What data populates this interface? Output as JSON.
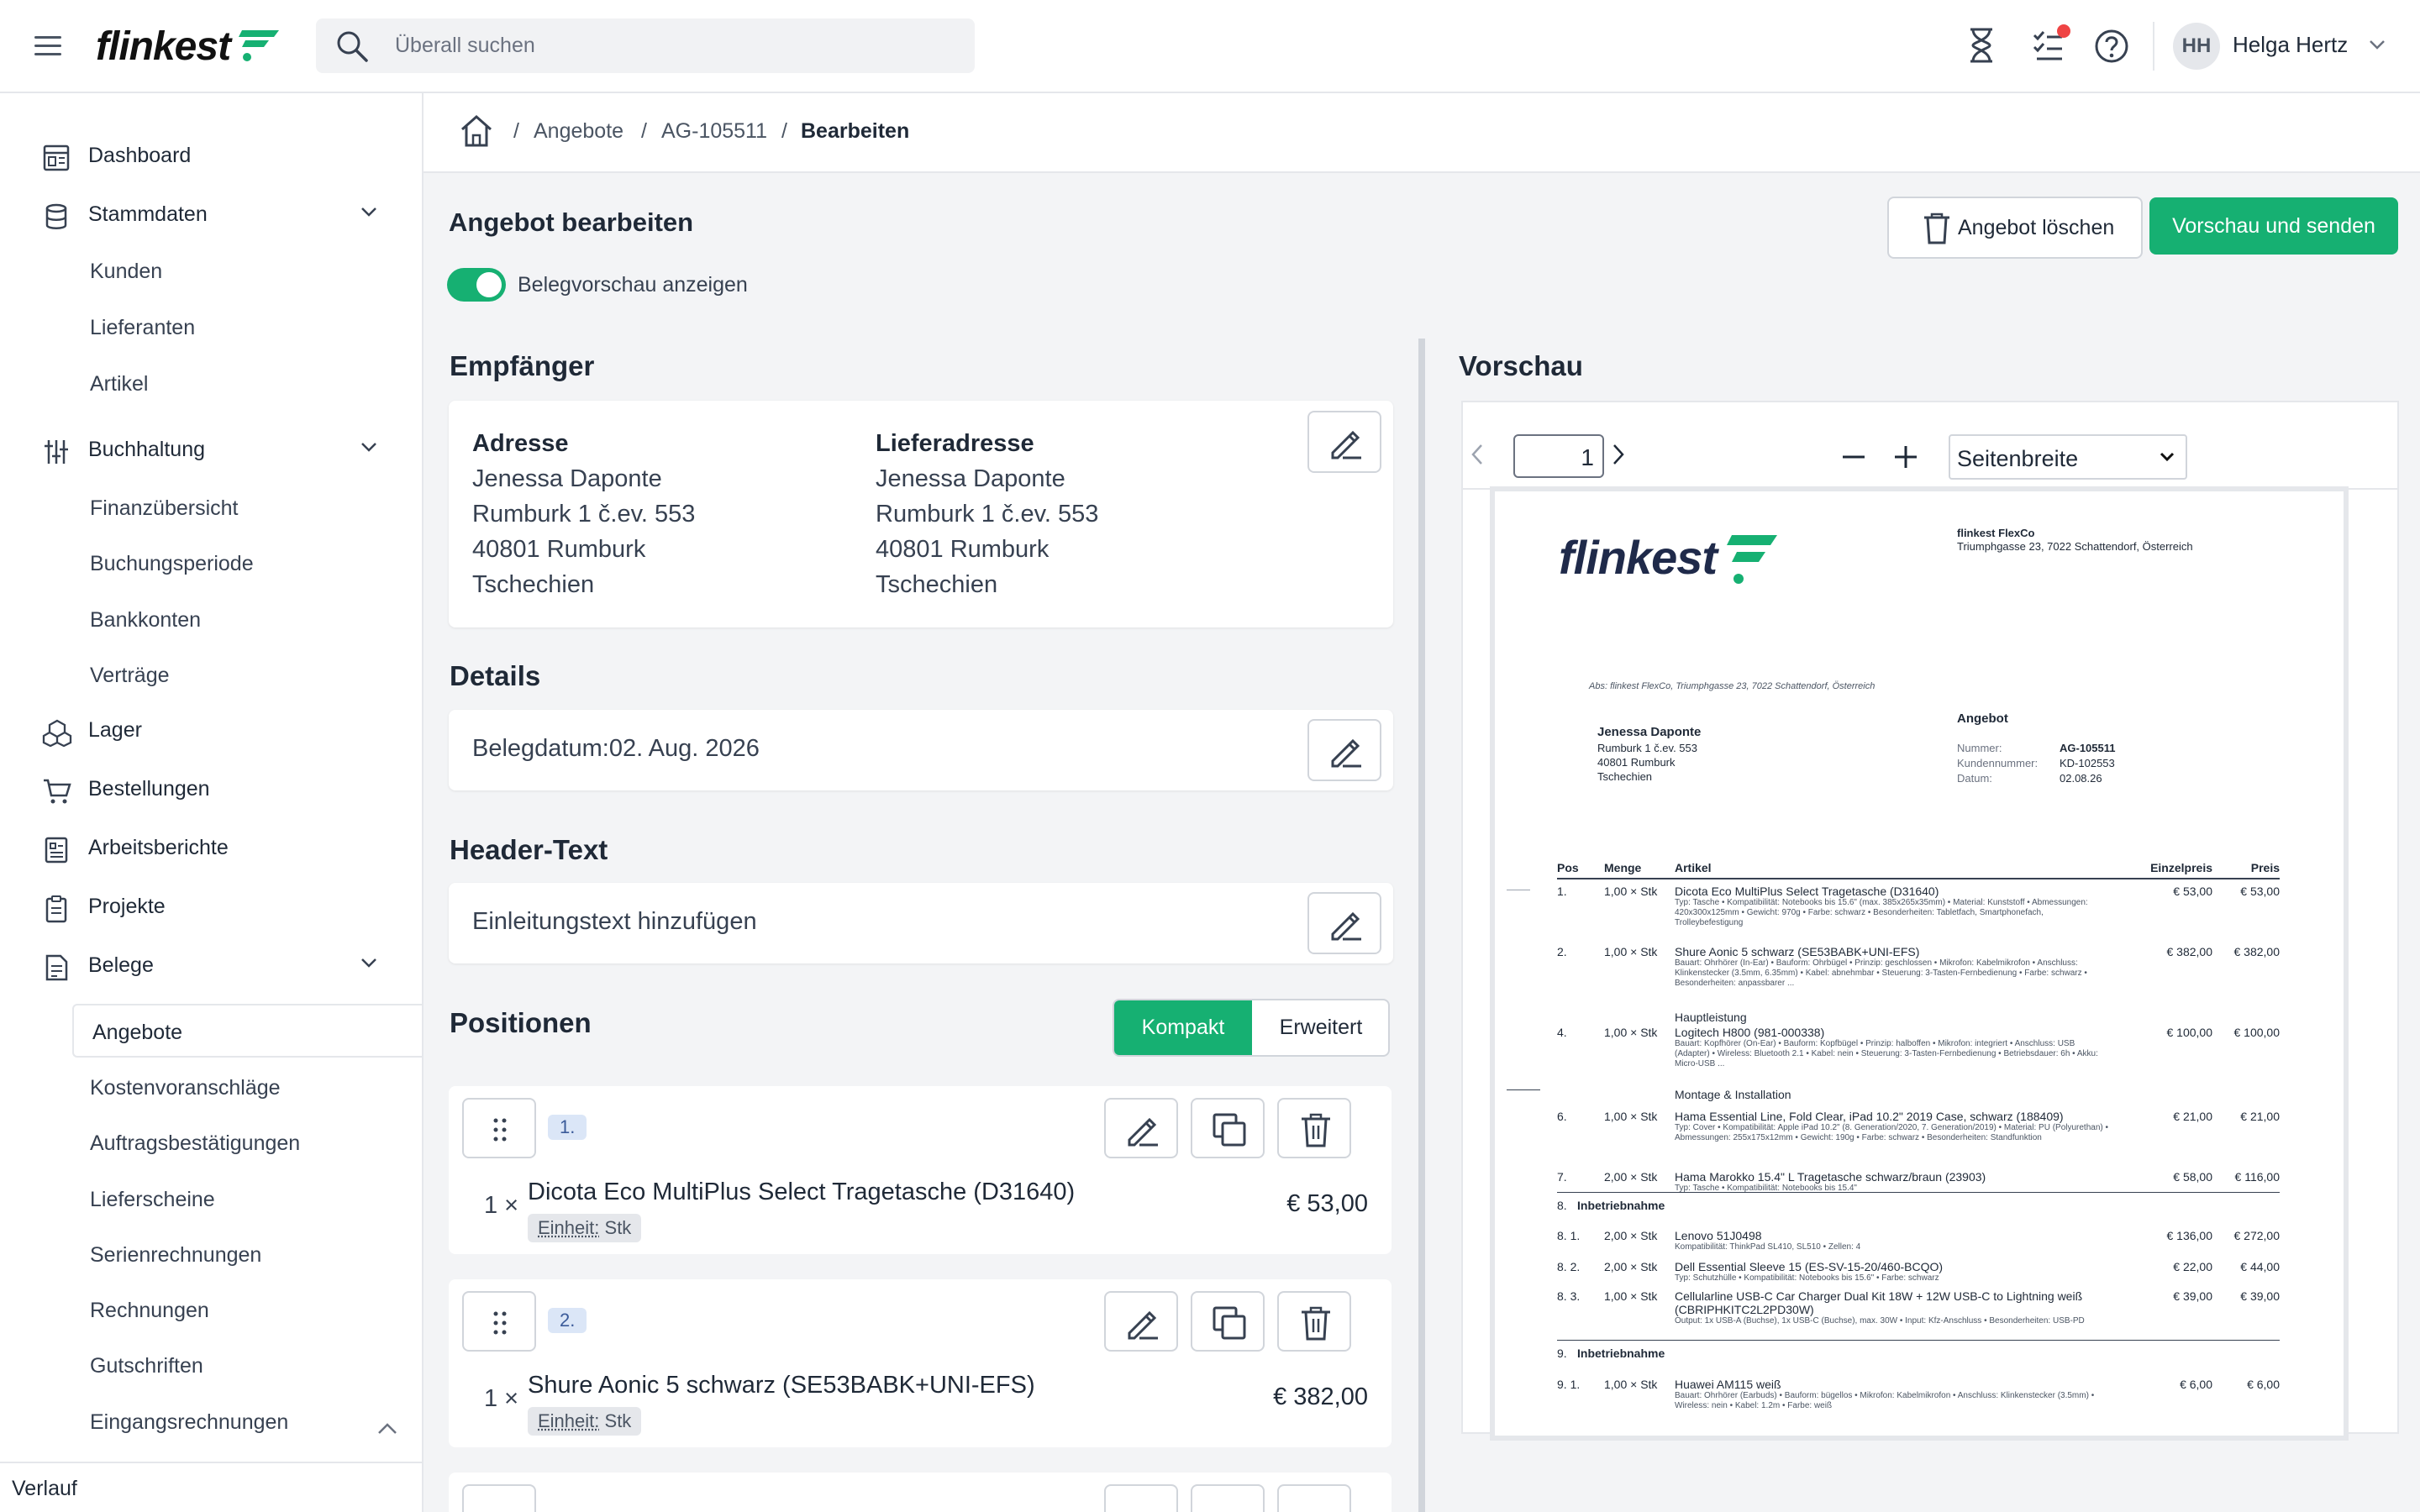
{
  "header": {
    "logo": "flinkest",
    "search_placeholder": "Überall suchen",
    "user_initials": "HH",
    "user_name": "Helga Hertz"
  },
  "sidebar": {
    "items": [
      {
        "label": "Dashboard"
      },
      {
        "label": "Stammdaten"
      },
      {
        "label": "Kunden"
      },
      {
        "label": "Lieferanten"
      },
      {
        "label": "Artikel"
      },
      {
        "label": "Buchhaltung"
      },
      {
        "label": "Finanzübersicht"
      },
      {
        "label": "Buchungsperiode"
      },
      {
        "label": "Bankkonten"
      },
      {
        "label": "Verträge"
      },
      {
        "label": "Lager"
      },
      {
        "label": "Bestellungen"
      },
      {
        "label": "Arbeitsberichte"
      },
      {
        "label": "Projekte"
      },
      {
        "label": "Belege"
      },
      {
        "label": "Angebote"
      },
      {
        "label": "Kostenvoranschläge"
      },
      {
        "label": "Auftragsbestätigungen"
      },
      {
        "label": "Lieferscheine"
      },
      {
        "label": "Serienrechnungen"
      },
      {
        "label": "Rechnungen"
      },
      {
        "label": "Gutschriften"
      },
      {
        "label": "Eingangsrechnungen"
      }
    ],
    "footer": "Verlauf"
  },
  "breadcrumb": {
    "items": [
      "Angebote",
      "AG-105511",
      "Bearbeiten"
    ]
  },
  "page": {
    "title": "Angebot bearbeiten",
    "toggle_label": "Belegvorschau anzeigen",
    "delete_label": "Angebot löschen",
    "send_label": "Vorschau und senden"
  },
  "recipient": {
    "title": "Empfänger",
    "address_label": "Adresse",
    "address": [
      "Jenessa Daponte",
      "Rumburk 1 č.ev. 553",
      "40801 Rumburk",
      "Tschechien"
    ],
    "delivery_label": "Lieferadresse",
    "delivery": [
      "Jenessa Daponte",
      "Rumburk 1 č.ev. 553",
      "40801 Rumburk",
      "Tschechien"
    ]
  },
  "details": {
    "title": "Details",
    "text": "Belegdatum:02. Aug. 2026"
  },
  "headertext": {
    "title": "Header-Text",
    "text": "Einleitungstext hinzufügen"
  },
  "positions": {
    "title": "Positionen",
    "seg_compact": "Kompakt",
    "seg_extended": "Erweitert",
    "unit_label": "Einheit:",
    "items": [
      {
        "num": "1.",
        "qty": "1 ×",
        "name": "Dicota Eco MultiPlus Select Tragetasche (D31640)",
        "unit": "Stk",
        "price": "€ 53,00"
      },
      {
        "num": "2.",
        "qty": "1 ×",
        "name": "Shure Aonic 5 schwarz (SE53BABK+UNI-EFS)",
        "unit": "Stk",
        "price": "€ 382,00"
      }
    ]
  },
  "preview": {
    "title": "Vorschau",
    "page": "1",
    "zoom": "Seitenbreite",
    "doc": {
      "company": "flinkest FlexCo",
      "company_addr": "Triumphgasse 23, 7022 Schattendorf, Österreich",
      "sender_line": "Abs: flinkest FlexCo, Triumphgasse 23, 7022 Schattendorf, Österreich",
      "recipient": [
        "Jenessa Daponte",
        "Rumburk 1 č.ev. 553",
        "40801 Rumburk",
        "Tschechien"
      ],
      "doc_type": "Angebot",
      "meta": [
        {
          "k": "Nummer:",
          "v": "AG-105511"
        },
        {
          "k": "Kundennummer:",
          "v": "KD-102553"
        },
        {
          "k": "Datum:",
          "v": "02.08.26"
        }
      ],
      "cols": [
        "Pos",
        "Menge",
        "Artikel",
        "Einzelpreis",
        "Preis"
      ],
      "rows": [
        {
          "pos": "1.",
          "qty": "1,00 × Stk",
          "name": "Dicota Eco MultiPlus Select Tragetasche (D31640)",
          "desc": "Typ: Tasche • Kompatibilität: Notebooks bis 15.6\" (max. 385x265x35mm) • Material: Kunststoff • Abmessungen: 420x300x125mm • Gewicht: 970g • Farbe: schwarz • Besonderheiten: Tabletfach, Smartphonefach, Trolleybefestigung",
          "ep": "€ 53,00",
          "p": "€ 53,00"
        },
        {
          "pos": "2.",
          "qty": "1,00 × Stk",
          "name": "Shure Aonic 5 schwarz (SE53BABK+UNI-EFS)",
          "desc": "Bauart: Ohrhörer (In-Ear) • Bauform: Ohrbügel • Prinzip: geschlossen • Mikrofon: Kabelmikrofon • Anschluss: Klinkenstecker (3.5mm, 6.35mm) • Kabel: abnehmbar • Steuerung: 3-Tasten-Fernbedienung • Farbe: schwarz • Besonderheiten: anpassbarer ...",
          "ep": "€ 382,00",
          "p": "€ 382,00"
        },
        {
          "pos": "",
          "qty": "",
          "name": "Hauptleistung",
          "desc": "",
          "ep": "",
          "p": ""
        },
        {
          "pos": "4.",
          "qty": "1,00 × Stk",
          "name": "Logitech H800 (981-000338)",
          "desc": "Bauart: Kopfhörer (On-Ear) • Bauform: Kopfbügel • Prinzip: halboffen • Mikrofon: integriert • Anschluss: USB (Adapter) • Wireless: Bluetooth 2.1 • Kabel: nein • Steuerung: 3-Tasten-Fernbedienung • Betriebsdauer: 6h • Akku: Micro-USB ...",
          "ep": "€ 100,00",
          "p": "€ 100,00"
        },
        {
          "pos": "",
          "qty": "",
          "name": "Montage & Installation",
          "desc": "",
          "ep": "",
          "p": ""
        },
        {
          "pos": "6.",
          "qty": "1,00 × Stk",
          "name": "Hama Essential Line, Fold Clear, iPad 10.2\" 2019 Case, schwarz (188409)",
          "desc": "Typ: Cover • Kompatibilität: Apple iPad 10.2\" (8. Generation/2020, 7. Generation/2019) • Material: PU (Polyurethan) • Abmessungen: 255x175x12mm • Gewicht: 190g • Farbe: schwarz • Besonderheiten: Standfunktion",
          "ep": "€ 21,00",
          "p": "€ 21,00"
        },
        {
          "pos": "7.",
          "qty": "2,00 × Stk",
          "name": "Hama Marokko 15.4\" L Tragetasche schwarz/braun (23903)",
          "desc": "Typ: Tasche • Kompatibilität: Notebooks bis 15.4\"",
          "ep": "€ 58,00",
          "p": "€ 116,00"
        },
        {
          "pos": "8.",
          "qty": "",
          "name": "Inbetriebnahme",
          "desc": "",
          "ep": "",
          "p": "",
          "group": true
        },
        {
          "pos": "8. 1.",
          "qty": "2,00 × Stk",
          "name": "Lenovo 51J0498",
          "desc": "Kompatibilität: ThinkPad SL410, SL510 • Zellen: 4",
          "ep": "€ 136,00",
          "p": "€ 272,00"
        },
        {
          "pos": "8. 2.",
          "qty": "2,00 × Stk",
          "name": "Dell Essential Sleeve 15 (ES-SV-15-20/460-BCQO)",
          "desc": "Typ: Schutzhülle • Kompatibilität: Notebooks bis 15.6\" • Farbe: schwarz",
          "ep": "€ 22,00",
          "p": "€ 44,00"
        },
        {
          "pos": "8. 3.",
          "qty": "1,00 × Stk",
          "name": "Cellularline USB-C Car Charger Dual Kit 18W + 12W USB-C to Lightning weiß (CBRIPHKITC2L2PD30W)",
          "desc": "Output: 1x USB-A (Buchse), 1x USB-C (Buchse), max. 30W • Input: Kfz-Anschluss • Besonderheiten: USB-PD",
          "ep": "€ 39,00",
          "p": "€ 39,00"
        },
        {
          "pos": "9.",
          "qty": "",
          "name": "Inbetriebnahme",
          "desc": "",
          "ep": "",
          "p": "",
          "group": true
        },
        {
          "pos": "9. 1.",
          "qty": "1,00 × Stk",
          "name": "Huawei AM115 weiß",
          "desc": "Bauart: Ohrhörer (Earbuds) • Bauform: bügellos • Mikrofon: Kabelmikrofon • Anschluss: Klinkenstecker (3.5mm) • Wireless: nein • Kabel: 1.2m • Farbe: weiß",
          "ep": "€ 6,00",
          "p": "€ 6,00"
        }
      ]
    }
  }
}
